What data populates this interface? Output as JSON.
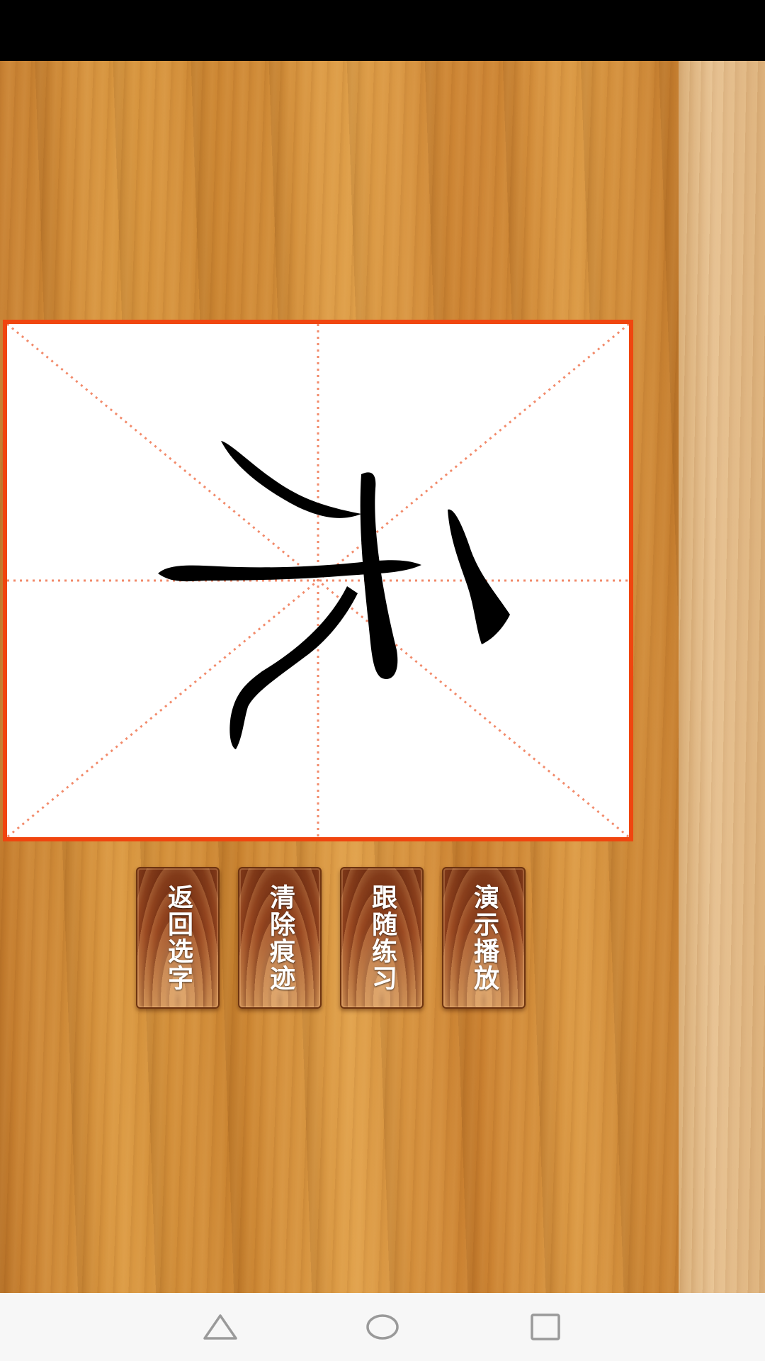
{
  "canvas": {
    "character": "禾",
    "border_color": "#f0450f",
    "guide_color": "#f28a6a"
  },
  "buttons": [
    {
      "label": "返回选字"
    },
    {
      "label": "清除痕迹"
    },
    {
      "label": "跟随练习"
    },
    {
      "label": "演示播放"
    }
  ],
  "nav": {
    "back_icon": "triangle-back-icon",
    "home_icon": "circle-home-icon",
    "recent_icon": "square-recent-icon"
  }
}
